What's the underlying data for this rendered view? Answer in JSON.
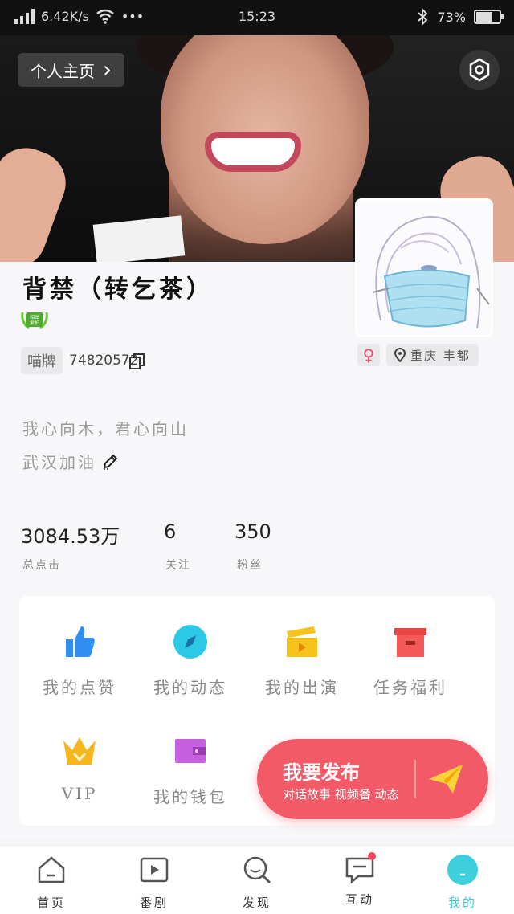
{
  "status_bar": {
    "speed": "6.42K/s",
    "dots": "•••",
    "time": "15:23",
    "battery_text": "73%",
    "battery_level": 0.73
  },
  "header": {
    "homepage_label": "个人主页",
    "chevron": "›"
  },
  "profile": {
    "nickname": "背禁（转乞茶）",
    "id_tag": "喵牌",
    "id_number": "74820572",
    "gender_symbol": "♀",
    "location": "重庆 丰都",
    "bio_line1": "我心向木，君心向山",
    "bio_line2": "武汉加油",
    "badge_text": "相出 爱护"
  },
  "stats": [
    {
      "value": "3084.53万",
      "label": "总点击"
    },
    {
      "value": "6",
      "label": "关注"
    },
    {
      "value": "350",
      "label": "粉丝"
    }
  ],
  "grid": [
    {
      "label": "我的点赞",
      "icon": "thumbs-up-icon",
      "color": "#2f8ef0"
    },
    {
      "label": "我的动态",
      "icon": "compass-icon",
      "color": "#2cc9e6"
    },
    {
      "label": "我的出演",
      "icon": "clapperboard-icon",
      "color": "#f7c21a"
    },
    {
      "label": "任务福利",
      "icon": "gift-box-icon",
      "color": "#f25a5a"
    },
    {
      "label": "VIP",
      "icon": "crown-icon",
      "color": "#f7b61e"
    },
    {
      "label": "我的钱包",
      "icon": "wallet-icon",
      "color": "#c85ee0"
    }
  ],
  "publish": {
    "title": "我要发布",
    "subtitle": "对话故事 视频番 动态",
    "icon": "paper-plane-icon"
  },
  "tabs": [
    {
      "label": "首页",
      "icon": "home-icon"
    },
    {
      "label": "番剧",
      "icon": "play-icon"
    },
    {
      "label": "发现",
      "icon": "search-icon"
    },
    {
      "label": "互动",
      "icon": "message-icon"
    },
    {
      "label": "我的",
      "icon": "profile-icon"
    }
  ]
}
